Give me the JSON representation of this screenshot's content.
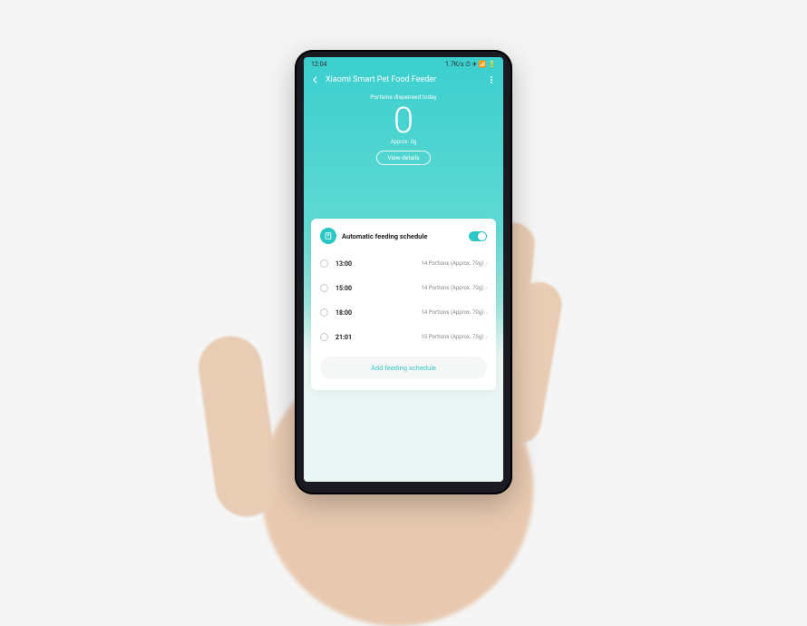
{
  "statusbar": {
    "time": "12:04",
    "right": "1.7K/s ⏱ ✈ 📶 🔋"
  },
  "appbar": {
    "title": "Xiaomi Smart Pet Food Feeder"
  },
  "hero": {
    "label": "Portions dispensed today",
    "value": "0",
    "sub": "Approx. 0g",
    "details_btn": "View details"
  },
  "schedule": {
    "title": "Automatic feeding schedule",
    "toggle_on": true,
    "rows": [
      {
        "time": "13:00",
        "detail": "14 Portions (Approx. 70g)"
      },
      {
        "time": "15:00",
        "detail": "14 Portions (Approx. 70g)"
      },
      {
        "time": "18:00",
        "detail": "14 Portions (Approx. 70g)"
      },
      {
        "time": "21:01",
        "detail": "15 Portions (Approx. 75g)"
      }
    ],
    "add_btn": "Add feeding schedule"
  },
  "colors": {
    "accent": "#2bc7c4"
  }
}
